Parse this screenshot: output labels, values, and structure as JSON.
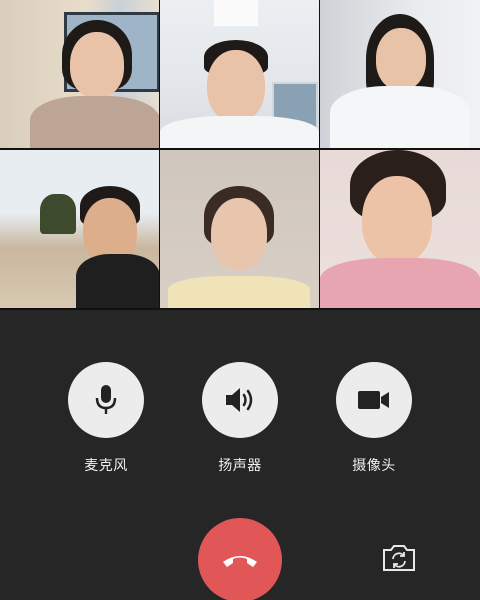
{
  "participants": [
    {
      "id": "p1",
      "name": ""
    },
    {
      "id": "p2",
      "name": ""
    },
    {
      "id": "p3",
      "name": ""
    },
    {
      "id": "p4",
      "name": ""
    },
    {
      "id": "p5",
      "name": ""
    },
    {
      "id": "p6",
      "name": ""
    }
  ],
  "controls": {
    "mic_label": "麦克风",
    "speaker_label": "扬声器",
    "camera_label": "摄像头"
  },
  "icons": {
    "mic": "microphone-icon",
    "speaker": "speaker-icon",
    "camera": "video-camera-icon",
    "hangup": "phone-hangup-icon",
    "flip": "camera-switch-icon"
  },
  "colors": {
    "background": "#262626",
    "control_circle": "#ececec",
    "hangup": "#e15757",
    "label_text": "#efefef"
  }
}
